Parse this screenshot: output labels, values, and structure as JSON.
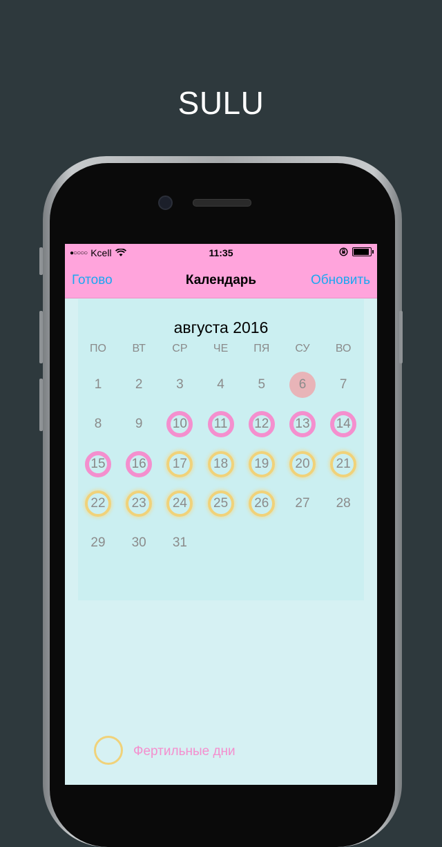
{
  "promo": {
    "title": "SULU"
  },
  "status_bar": {
    "signal": "●○○○○",
    "carrier": "Kcell",
    "time": "11:35"
  },
  "nav": {
    "left_button": "Готово",
    "title": "Календарь",
    "right_button": "Обновить"
  },
  "calendar": {
    "month_title": "августа 2016",
    "weekdays": [
      "ПО",
      "ВТ",
      "СР",
      "ЧЕ",
      "ПЯ",
      "СУ",
      "ВО"
    ],
    "first_weekday_index": 0,
    "days": [
      {
        "n": "1",
        "t": ""
      },
      {
        "n": "2",
        "t": ""
      },
      {
        "n": "3",
        "t": ""
      },
      {
        "n": "4",
        "t": ""
      },
      {
        "n": "5",
        "t": ""
      },
      {
        "n": "6",
        "t": "ovulation"
      },
      {
        "n": "7",
        "t": ""
      },
      {
        "n": "8",
        "t": ""
      },
      {
        "n": "9",
        "t": ""
      },
      {
        "n": "10",
        "t": "period"
      },
      {
        "n": "11",
        "t": "period"
      },
      {
        "n": "12",
        "t": "period"
      },
      {
        "n": "13",
        "t": "period"
      },
      {
        "n": "14",
        "t": "period"
      },
      {
        "n": "15",
        "t": "period"
      },
      {
        "n": "16",
        "t": "period"
      },
      {
        "n": "17",
        "t": "fertile"
      },
      {
        "n": "18",
        "t": "fertile"
      },
      {
        "n": "19",
        "t": "fertile"
      },
      {
        "n": "20",
        "t": "fertile"
      },
      {
        "n": "21",
        "t": "fertile"
      },
      {
        "n": "22",
        "t": "fertile"
      },
      {
        "n": "23",
        "t": "fertile"
      },
      {
        "n": "24",
        "t": "fertile"
      },
      {
        "n": "25",
        "t": "fertile"
      },
      {
        "n": "26",
        "t": "fertile"
      },
      {
        "n": "27",
        "t": ""
      },
      {
        "n": "28",
        "t": ""
      },
      {
        "n": "29",
        "t": ""
      },
      {
        "n": "30",
        "t": ""
      },
      {
        "n": "31",
        "t": ""
      }
    ]
  },
  "legend": {
    "label": "Фертильные дни"
  },
  "colors": {
    "nav_bg": "#ffa4dc",
    "link": "#1aa7f0",
    "period": "#f48fce",
    "fertile": "#f0d27a",
    "ovulation": "#e8b4b8",
    "screen_bg": "#d6f1f3"
  }
}
